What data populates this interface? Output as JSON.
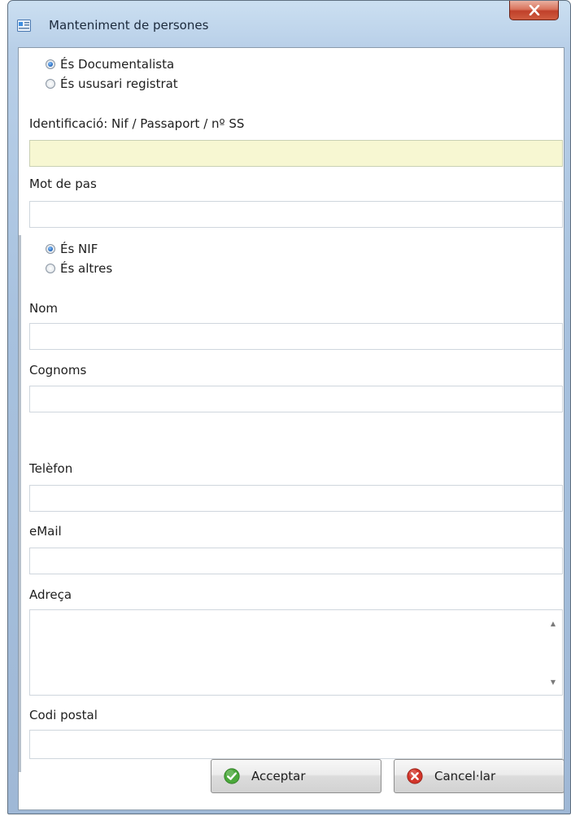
{
  "window": {
    "title": "Manteniment de persones"
  },
  "user_type": {
    "options": [
      {
        "label": "És Documentalista",
        "selected": true
      },
      {
        "label": "És ususari registrat",
        "selected": false
      }
    ]
  },
  "fields": {
    "identification": {
      "label": "Identificació: Nif / Passaport / nº SS",
      "value": ""
    },
    "password": {
      "label": "Mot de pas",
      "value": ""
    },
    "first_name": {
      "label": "Nom",
      "value": ""
    },
    "last_name": {
      "label": "Cognoms",
      "value": ""
    },
    "phone": {
      "label": "Telèfon",
      "value": ""
    },
    "email": {
      "label": "eMail",
      "value": ""
    },
    "address": {
      "label": "Adreça",
      "value": ""
    },
    "postal_code": {
      "label": "Codi postal",
      "value": ""
    }
  },
  "id_type": {
    "options": [
      {
        "label": "És NIF",
        "selected": true
      },
      {
        "label": "És altres",
        "selected": false
      }
    ]
  },
  "buttons": {
    "accept": "Acceptar",
    "cancel": "Cancel·lar"
  },
  "colors": {
    "highlight_field": "#f7f7d2",
    "accept_icon": "#4aa83a",
    "cancel_icon": "#d2352a"
  }
}
